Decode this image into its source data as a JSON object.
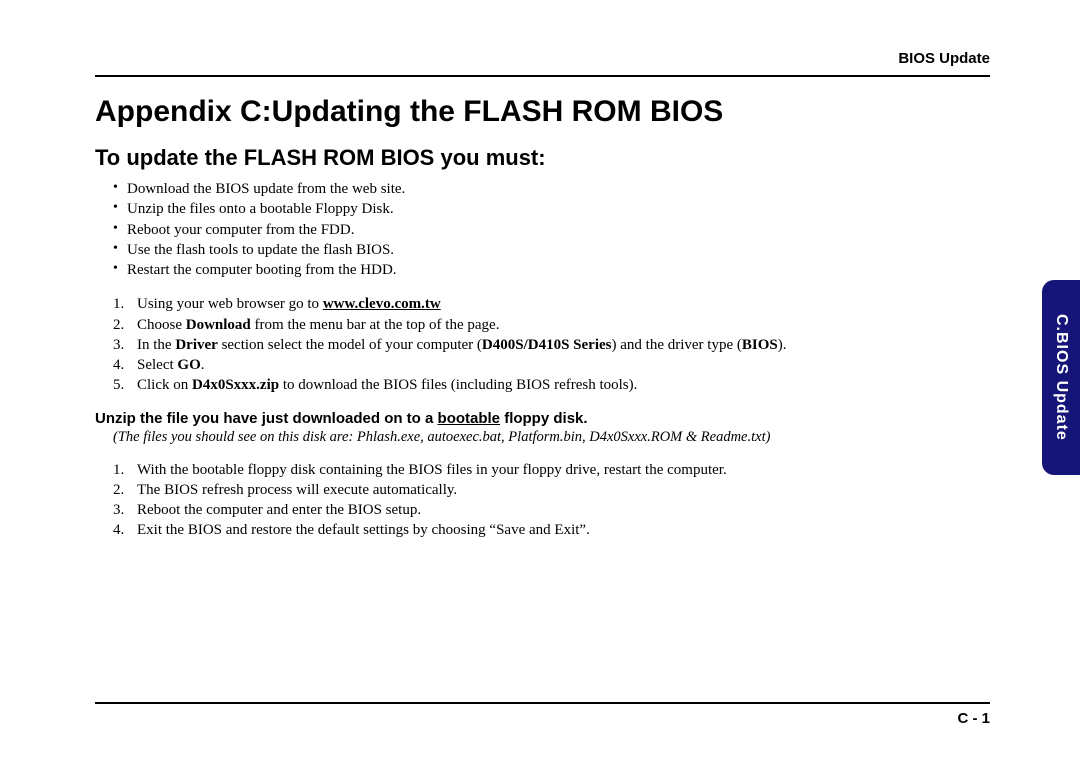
{
  "header": {
    "right": "BIOS Update"
  },
  "title": "Appendix C:Updating the FLASH ROM BIOS",
  "subtitle": "To update the FLASH ROM BIOS you must:",
  "bullets": [
    "Download the BIOS update from the web site.",
    "Unzip the files onto a bootable Floppy Disk.",
    "Reboot your computer from the FDD.",
    "Use the flash tools to update the flash BIOS.",
    "Restart the computer booting from the HDD."
  ],
  "steps1": [
    {
      "n": "1.",
      "pre": "Using your web browser go to ",
      "link": "www.clevo.com.tw",
      "post": ""
    },
    {
      "n": "2.",
      "pre": "Choose ",
      "b1": "Download",
      "post": " from the menu bar at the top of the page."
    },
    {
      "n": "3.",
      "pre": "In the ",
      "b1": "Driver",
      "mid": " section select the model of your computer (",
      "b2": "D400S/D410S Series",
      "mid2": ") and the driver type (",
      "b3": "BIOS",
      "post": ")."
    },
    {
      "n": "4.",
      "pre": "Select ",
      "b1": "GO",
      "post": "."
    },
    {
      "n": "5.",
      "pre": "Click on ",
      "b1": "D4x0Sxxx.zip",
      "post": " to download the BIOS files (including BIOS refresh tools)."
    }
  ],
  "instruction": {
    "pre": "Unzip the file you have just downloaded on to a ",
    "underline": "bootable",
    "post": " floppy disk."
  },
  "note": "(The files you should see on this disk are: Phlash.exe, autoexec.bat, Platform.bin, D4x0Sxxx.ROM & Readme.txt)",
  "steps2": [
    {
      "n": "1.",
      "t": "With the bootable floppy disk containing the BIOS files in your floppy drive, restart the computer."
    },
    {
      "n": "2.",
      "t": "The BIOS refresh process will execute automatically."
    },
    {
      "n": "3.",
      "t": "Reboot the computer and enter the BIOS setup."
    },
    {
      "n": "4.",
      "t": "Exit the BIOS and restore the default settings by choosing “Save and Exit”."
    }
  ],
  "sidetab": "C.BIOS Update",
  "pagenum": "C  -  1"
}
